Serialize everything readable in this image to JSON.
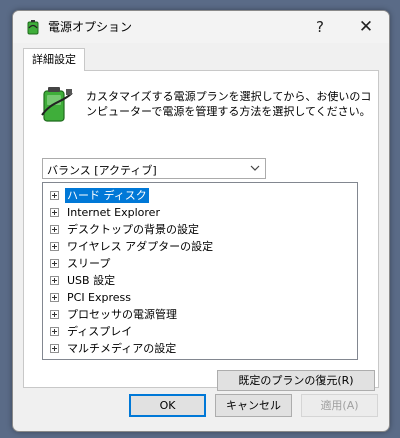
{
  "window": {
    "title": "電源オプション",
    "help_glyph": "?",
    "close_glyph": "✕"
  },
  "tab": {
    "label": "詳細設定"
  },
  "description": "カスタマイズする電源プランを選択してから、お使いのコンピューターで電源を管理する方法を選択してください。",
  "plan_select": {
    "value": "バランス [アクティブ]"
  },
  "tree": {
    "items": [
      {
        "label": "ハード ディスク",
        "selected": true
      },
      {
        "label": "Internet Explorer"
      },
      {
        "label": "デスクトップの背景の設定"
      },
      {
        "label": "ワイヤレス アダプターの設定"
      },
      {
        "label": "スリープ"
      },
      {
        "label": "USB 設定"
      },
      {
        "label": "PCI Express"
      },
      {
        "label": "プロセッサの電源管理"
      },
      {
        "label": "ディスプレイ"
      },
      {
        "label": "マルチメディアの設定"
      }
    ]
  },
  "buttons": {
    "restore": "既定のプランの復元(R)",
    "ok": "OK",
    "cancel": "キャンセル",
    "apply": "適用(A)"
  },
  "colors": {
    "selection": "#0078d7",
    "battery_green": "#3fae3a"
  }
}
